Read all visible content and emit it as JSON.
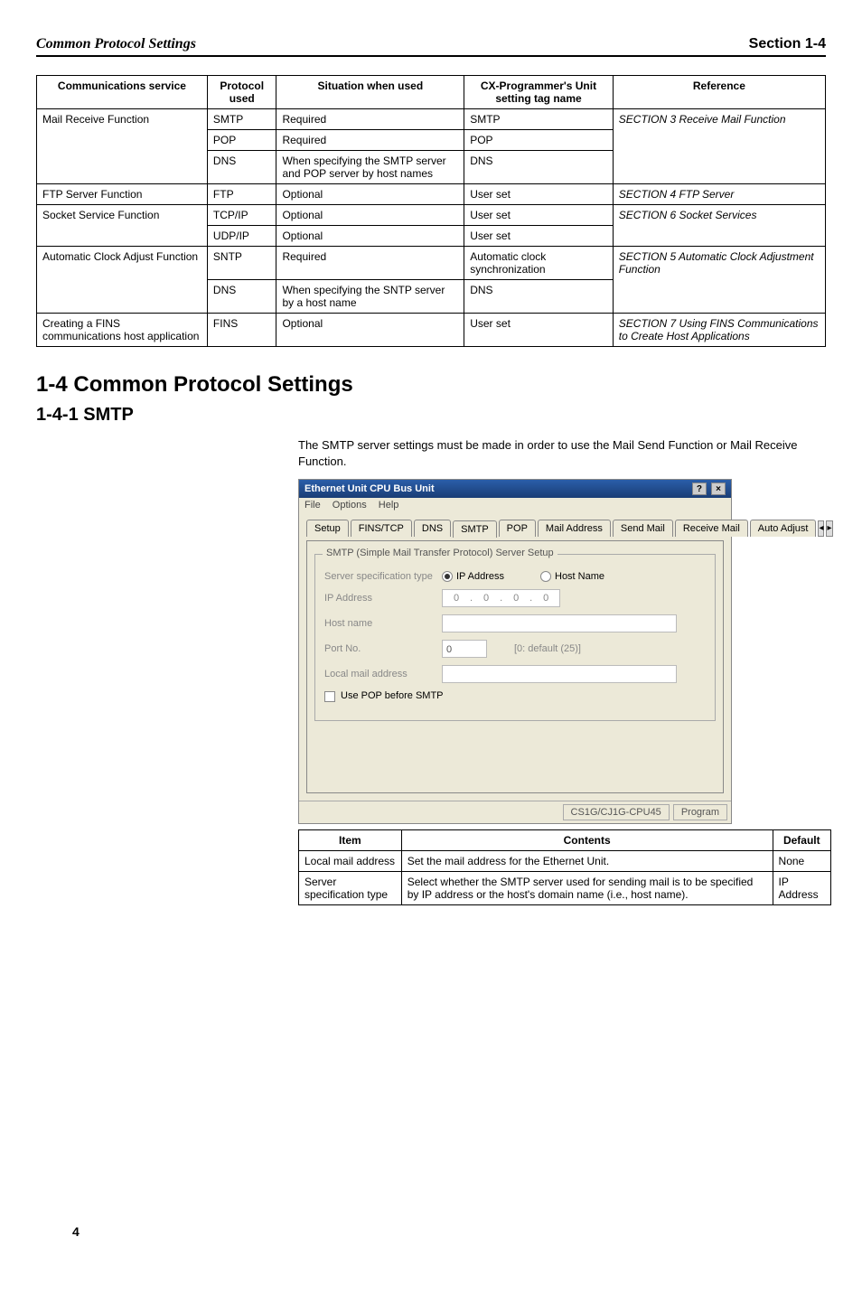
{
  "header": {
    "left": "Common Protocol Settings",
    "right": "Section 1-4"
  },
  "proto_table": {
    "headers": [
      "Communications service",
      "Protocol used",
      "Situation when used",
      "CX-Programmer's Unit setting tag name",
      "Reference"
    ],
    "rows": [
      {
        "c0": "Mail Receive Function",
        "c1": "SMTP",
        "c2": "Required",
        "c3": "SMTP",
        "c4": "SECTION 3 Receive Mail Function"
      },
      {
        "c0": "",
        "c1": "POP",
        "c2": "Required",
        "c3": "POP",
        "c4": ""
      },
      {
        "c0": "",
        "c1": "DNS",
        "c2": "When specifying the SMTP server and POP server by host names",
        "c3": "DNS",
        "c4": ""
      },
      {
        "c0": "FTP Server Function",
        "c1": "FTP",
        "c2": "Optional",
        "c3": "User set",
        "c4": "SECTION 4 FTP Server"
      },
      {
        "c0": "Socket Service Function",
        "c1": "TCP/IP",
        "c2": "Optional",
        "c3": "User set",
        "c4": "SECTION 6 Socket Services"
      },
      {
        "c0": "",
        "c1": "UDP/IP",
        "c2": "Optional",
        "c3": "User set",
        "c4": ""
      },
      {
        "c0": "Automatic Clock Adjust Function",
        "c1": "SNTP",
        "c2": "Required",
        "c3": "Automatic clock synchronization",
        "c4": "SECTION 5 Automatic Clock Adjustment Function"
      },
      {
        "c0": "",
        "c1": "DNS",
        "c2": "When specifying the SNTP server by a host name",
        "c3": "DNS",
        "c4": ""
      },
      {
        "c0": "Creating a FINS communications host application",
        "c1": "FINS",
        "c2": "Optional",
        "c3": "User set",
        "c4": "SECTION 7 Using FINS Communications to Create Host Applications"
      }
    ]
  },
  "section_title": "1-4   Common Protocol Settings",
  "subsection_title": "1-4-1    SMTP",
  "lead_para": "The SMTP server settings must be made in order to use the Mail Send Function or Mail Receive Function.",
  "dialog": {
    "title": "Ethernet Unit CPU Bus Unit",
    "menu": [
      "File",
      "Options",
      "Help"
    ],
    "tabs": [
      "Setup",
      "FINS/TCP",
      "DNS",
      "SMTP",
      "POP",
      "Mail Address",
      "Send Mail",
      "Receive Mail",
      "Auto Adjust"
    ],
    "active_tab_index": 3,
    "fieldset_legend": "SMTP (Simple Mail Transfer Protocol) Server Setup",
    "labels": {
      "spec_type": "Server specification type",
      "ip_address": "IP Address",
      "host_name": "Host name",
      "port_no": "Port No.",
      "local_mail": "Local mail address",
      "use_pop": "Use POP before SMTP"
    },
    "radios": {
      "ip_address": "IP Address",
      "host_name": "Host Name"
    },
    "ip_value": [
      "0",
      "0",
      "0",
      "0"
    ],
    "port_value": "0",
    "port_hint": "[0: default (25)]",
    "status": {
      "model": "CS1G/CJ1G-CPU45",
      "mode": "Program"
    }
  },
  "items_table": {
    "headers": [
      "Item",
      "Contents",
      "Default"
    ],
    "rows": [
      {
        "item": "Local mail address",
        "contents": "Set the mail address for the Ethernet Unit.",
        "default": "None"
      },
      {
        "item": "Server specification type",
        "contents": "Select whether the SMTP server used for sending mail is to be specified by IP address or the host's domain name (i.e., host name).",
        "default": "IP Address"
      }
    ]
  },
  "page_number": "4"
}
